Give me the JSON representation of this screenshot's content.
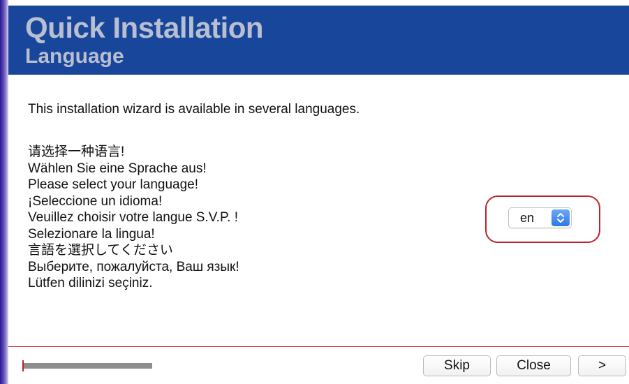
{
  "header": {
    "title": "Quick Installation",
    "subtitle": "Language"
  },
  "intro": "This installation wizard is available in several languages.",
  "language_prompts": [
    "请选择一种语言!",
    "Wählen Sie eine Sprache aus!",
    "Please select your language!",
    "¡Seleccione un idioma!",
    "Veuillez choisir votre langue S.V.P. !",
    "Selezionare la lingua!",
    "言語を選択してください",
    "Выберите, пожалуйста, Ваш язык!",
    "Lütfen dilinizi seçiniz."
  ],
  "language_select": {
    "value": "en",
    "icon": "up-down-chevron-icon"
  },
  "progress": {
    "fraction": 0.1
  },
  "buttons": {
    "skip": "Skip",
    "close": "Close",
    "next": ">"
  },
  "colors": {
    "header_bg": "#17469b",
    "header_text": "#b9bed0",
    "highlight_border": "#b8252b",
    "footer_line": "#c0282e",
    "stepper_blue": "#2f77e6"
  }
}
